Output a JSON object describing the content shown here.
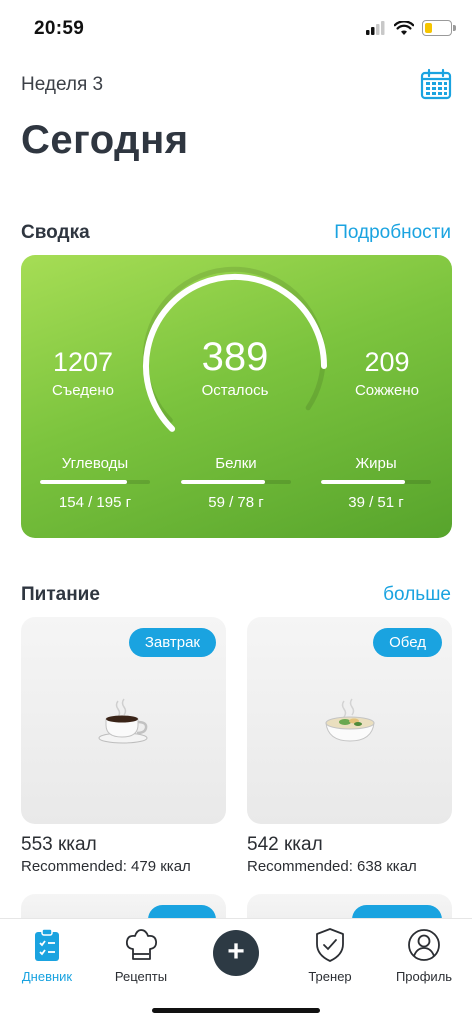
{
  "status": {
    "time": "20:59",
    "battery_level": 0.3
  },
  "header": {
    "week": "Неделя 3",
    "title": "Сегодня"
  },
  "summary": {
    "title": "Сводка",
    "link": "Подробности",
    "eaten": {
      "value": "1207",
      "label": "Съедено"
    },
    "left": {
      "value": "389",
      "label": "Осталось"
    },
    "burned": {
      "value": "209",
      "label": "Сожжено"
    },
    "gauge_progress": 0.75,
    "macros": [
      {
        "name": "Углеводы",
        "value": "154 / 195 г",
        "progress": 0.79
      },
      {
        "name": "Белки",
        "value": "59 / 78 г",
        "progress": 0.76
      },
      {
        "name": "Жиры",
        "value": "39 / 51 г",
        "progress": 0.76
      }
    ]
  },
  "nutrition": {
    "title": "Питание",
    "link": "больше",
    "meals": [
      {
        "tag": "Завтрак",
        "kcal": "553 ккал",
        "recommended": "Recommended: 479 ккал",
        "icon": "coffee-cup-icon"
      },
      {
        "tag": "Обед",
        "kcal": "542 ккал",
        "recommended": "Recommended: 638 ккал",
        "icon": "soup-bowl-icon"
      }
    ]
  },
  "tabs": [
    {
      "label": "Дневник",
      "icon": "clipboard-icon",
      "active": true
    },
    {
      "label": "Рецепты",
      "icon": "chef-hat-icon",
      "active": false
    },
    {
      "label": "",
      "icon": "plus-icon",
      "active": false
    },
    {
      "label": "Тренер",
      "icon": "shield-check-icon",
      "active": false
    },
    {
      "label": "Профиль",
      "icon": "profile-icon",
      "active": false
    }
  ],
  "colors": {
    "accent": "#1aa3e0",
    "card_green_start": "#a6dd55",
    "card_green_end": "#57a42c",
    "add_button": "#2d3a44"
  }
}
